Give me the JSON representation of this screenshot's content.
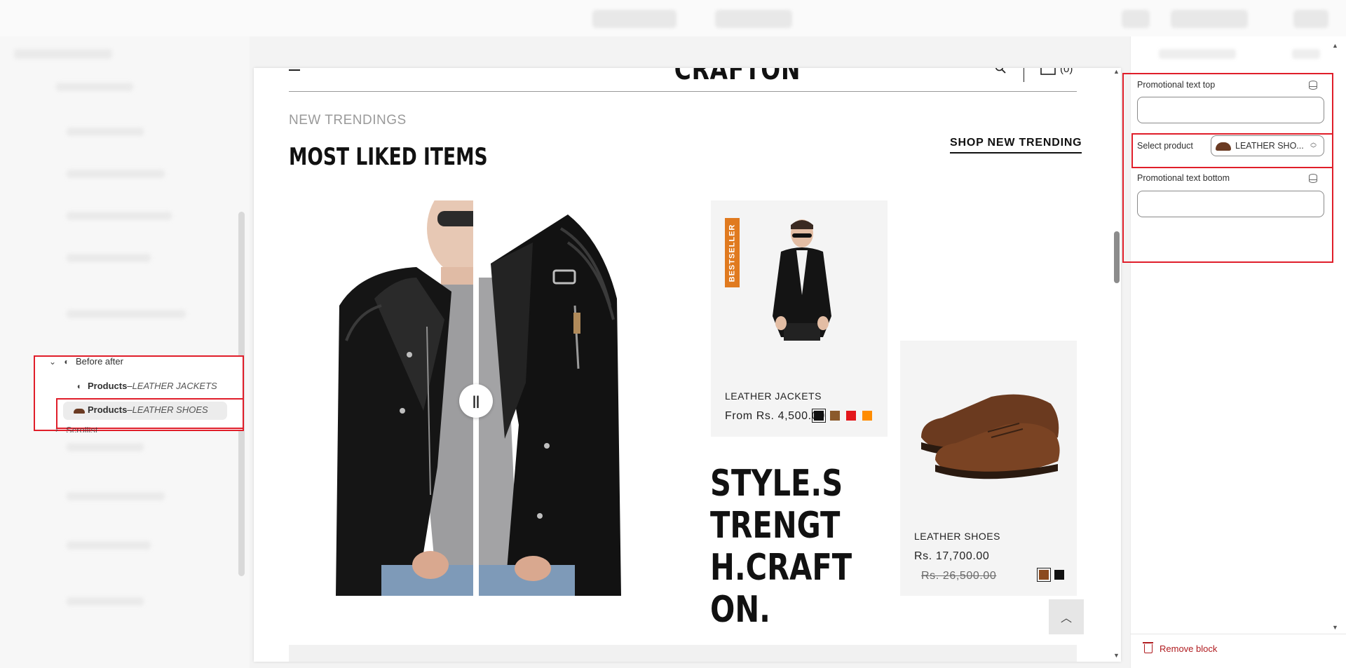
{
  "sidebar": {
    "tree": {
      "parent_label": "Before after",
      "items": [
        {
          "type": "Products",
          "separator": " – ",
          "name": "LEATHER JACKETS"
        },
        {
          "type": "Products",
          "separator": " – ",
          "name": "LEATHER SHOES"
        }
      ],
      "next_label": "Scrollist"
    }
  },
  "preview": {
    "logo": "CRAFTON",
    "cart_count": "(0)",
    "eyebrow": "NEW TRENDINGS",
    "section_title": "MOST LIKED ITEMS",
    "shop_link": "SHOP NEW TRENDING",
    "before_after": {
      "handle_icon": "pause-bars-icon"
    },
    "products": [
      {
        "badge": "BESTSELLER",
        "name": "LEATHER JACKETS",
        "price": "From Rs. 4,500.00",
        "swatches": [
          "#111111",
          "#8b5a2b",
          "#e3171c",
          "#ff8c00"
        ],
        "selected_swatch": 0
      },
      {
        "name": "LEATHER SHOES",
        "price": "Rs. 17,700.00",
        "compare_price": "Rs. 26,500.00",
        "swatches": [
          "#8b4a1f",
          "#111111"
        ],
        "selected_swatch": 0
      }
    ],
    "tagline": "STYLE.STRENGTH.CRAFTON.",
    "back_to_top_icon": "chevron-up-icon"
  },
  "settings": {
    "promo_top_label": "Promotional text top",
    "promo_top_value": "",
    "select_product_label": "Select product",
    "selected_product": "LEATHER SHO...",
    "promo_bottom_label": "Promotional text bottom",
    "promo_bottom_value": "",
    "remove_block_label": "Remove block"
  },
  "colors": {
    "highlight": "#e01e2a",
    "badge": "#e07a1f",
    "danger": "#b01c20"
  }
}
